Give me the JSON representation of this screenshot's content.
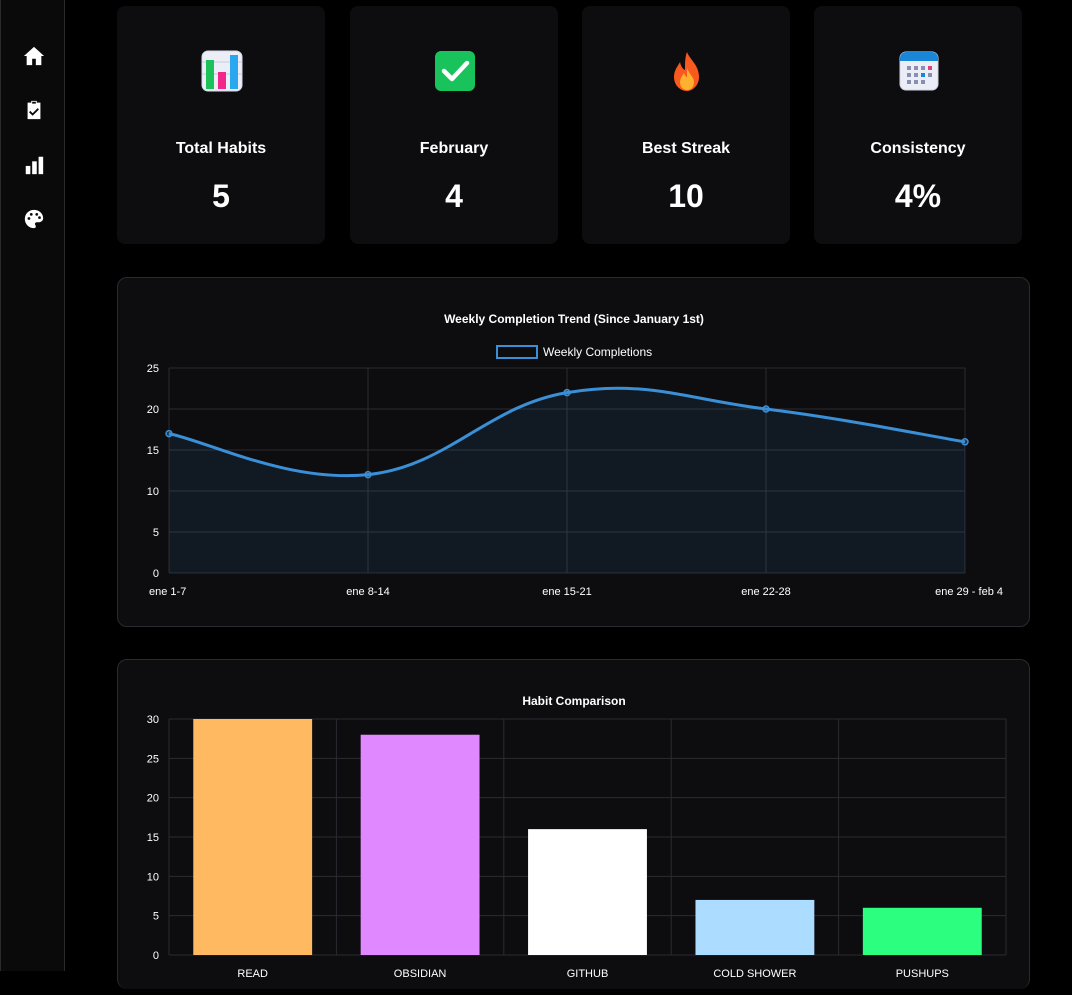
{
  "stats": [
    {
      "label": "Total Habits",
      "value": "5",
      "icon": "bar-chart-icon"
    },
    {
      "label": "February",
      "value": "4",
      "icon": "check-mark-icon"
    },
    {
      "label": "Best Streak",
      "value": "10",
      "icon": "fire-icon"
    },
    {
      "label": "Consistency",
      "value": "4%",
      "icon": "calendar-icon"
    }
  ],
  "nav": [
    "home-icon",
    "clipboard-check-icon",
    "stats-icon",
    "palette-icon"
  ],
  "chart_data": [
    {
      "type": "line",
      "title": "Weekly Completion Trend (Since January 1st)",
      "categories": [
        "ene 1-7",
        "ene 8-14",
        "ene 15-21",
        "ene 22-28",
        "ene 29 - feb 4"
      ],
      "series": [
        {
          "name": "Weekly Completions",
          "values": [
            17,
            12,
            22,
            20,
            16
          ],
          "color": "#3a8fd6"
        }
      ],
      "ylim": [
        0,
        25
      ],
      "yticks": [
        0,
        5,
        10,
        15,
        20,
        25
      ],
      "grid": true,
      "legend": "top"
    },
    {
      "type": "bar",
      "title": "Habit Comparison",
      "categories": [
        "READ",
        "OBSIDIAN",
        "GITHUB",
        "COLD SHOWER",
        "PUSHUPS"
      ],
      "values": [
        30,
        28,
        16,
        7,
        6
      ],
      "colors": [
        "#ffba61",
        "#e088ff",
        "#ffffff",
        "#acdcff",
        "#2cff80"
      ],
      "ylim": [
        0,
        30
      ],
      "yticks": [
        0,
        5,
        10,
        15,
        20,
        25,
        30
      ],
      "grid": true
    }
  ]
}
